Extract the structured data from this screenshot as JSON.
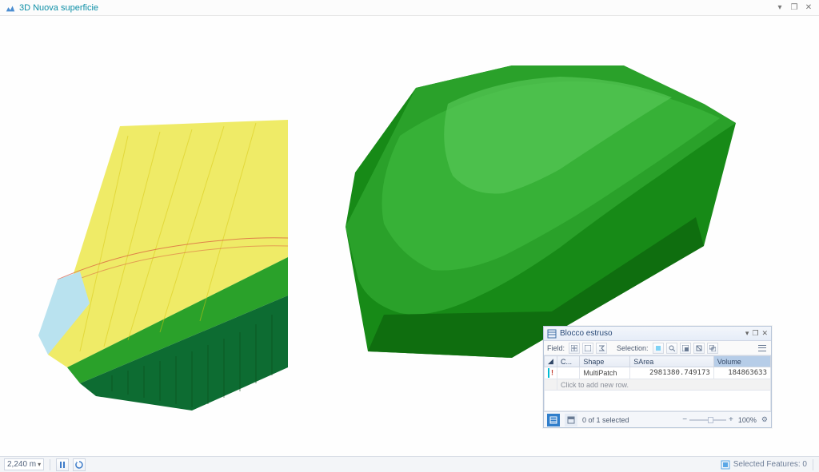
{
  "titlebar": {
    "title": "3D Nuova superficie"
  },
  "panel": {
    "title": "Blocco estruso",
    "toolbar": {
      "field_label": "Field:",
      "selection_label": "Selection:"
    },
    "headers": {
      "collapse": "C...",
      "shape": "Shape",
      "sarea": "SArea",
      "volume": "Volume"
    },
    "rows": [
      {
        "shape": "MultiPatch",
        "sarea": "2981380.749173",
        "volume": "184863633"
      }
    ],
    "hint_row": "Click to add new row.",
    "footer": {
      "count_text": "0 of 1 selected",
      "zoom_pct": "100%"
    }
  },
  "status": {
    "scale_value": "2,240 m",
    "selected_features": "Selected Features: 0"
  }
}
